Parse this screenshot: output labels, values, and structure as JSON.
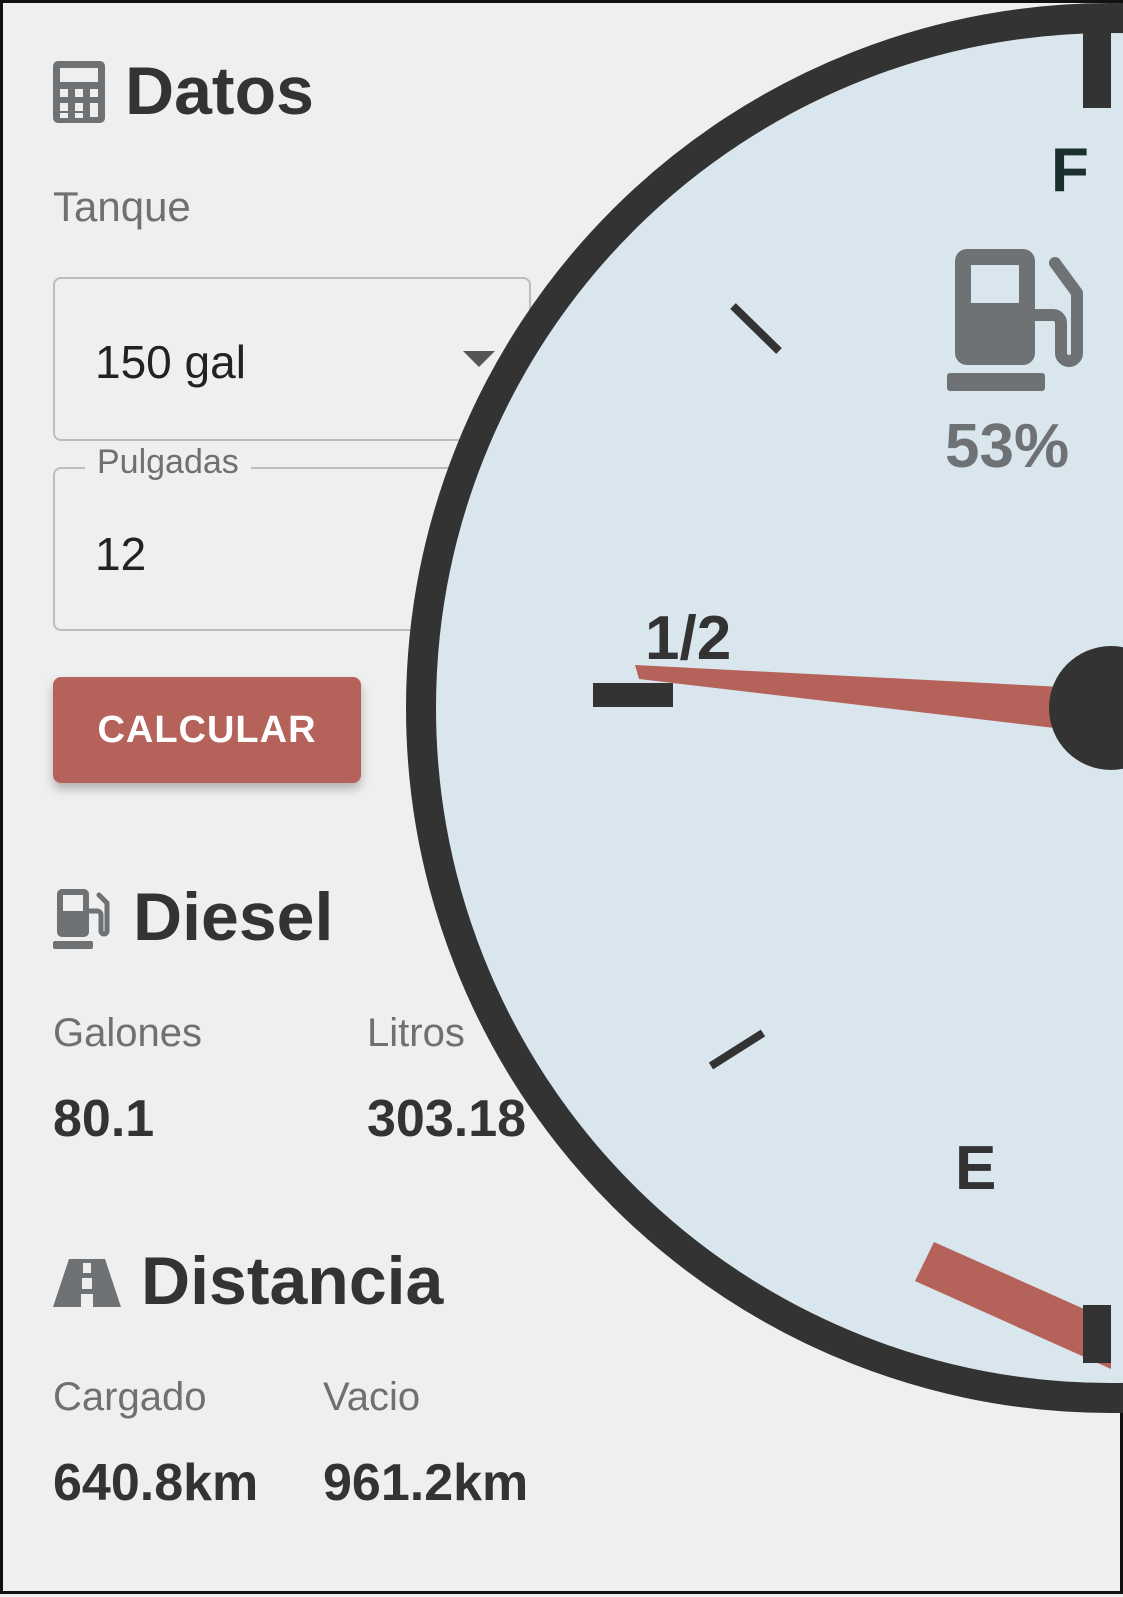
{
  "datos": {
    "title": "Datos",
    "tank_label": "Tanque",
    "tank_value": "150 gal",
    "inches_label": "Pulgadas",
    "inches_value": "12",
    "calc_button": "CALCULAR"
  },
  "diesel": {
    "title": "Diesel",
    "gallons_label": "Galones",
    "gallons_value": "80.1",
    "liters_label": "Litros",
    "liters_value": "303.18"
  },
  "distance": {
    "title": "Distancia",
    "loaded_label": "Cargado",
    "loaded_value": "640.8km",
    "empty_label": "Vacio",
    "empty_value": "961.2km"
  },
  "gauge": {
    "full_label": "F",
    "half_label": "1/2",
    "empty_label": "E",
    "percent_text": "53%",
    "fill_fraction": 0.53,
    "colors": {
      "face": "#dae6ee",
      "rim": "#333333",
      "needle": "#b5625a",
      "reserve": "#b5625a",
      "icon": "#6e7275"
    }
  },
  "icons": {
    "datos": "calculator-icon",
    "diesel": "fuel-pump-icon",
    "distance": "road-icon",
    "gauge": "fuel-pump-icon",
    "dropdown": "caret-down-icon"
  }
}
